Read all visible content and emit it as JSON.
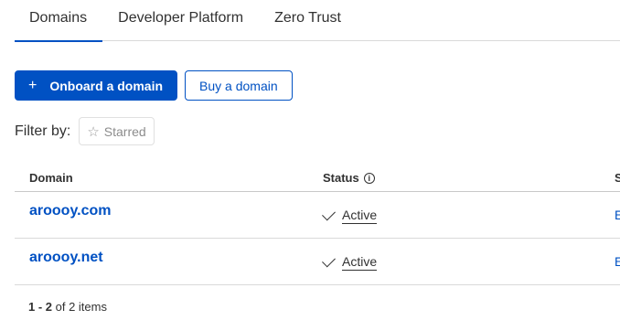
{
  "tabs": [
    {
      "label": "Domains",
      "active": true
    },
    {
      "label": "Developer Platform",
      "active": false
    },
    {
      "label": "Zero Trust",
      "active": false
    }
  ],
  "actions": {
    "onboard_icon": "plus-icon",
    "onboard_label": "Onboard a domain",
    "buy_label": "Buy a domain"
  },
  "filter": {
    "label": "Filter by:",
    "starred_icon": "star-icon",
    "starred_label": "Starred"
  },
  "table": {
    "columns": [
      "Domain",
      "Status",
      "S"
    ],
    "rows": [
      {
        "domain": "aroooy.com",
        "status": "Active",
        "third": "E"
      },
      {
        "domain": "aroooy.net",
        "status": "Active",
        "third": "E"
      }
    ]
  },
  "pagination": {
    "range": "1 - 2",
    "suffix": " of 2 items"
  },
  "colors": {
    "accent": "#0051c3",
    "text": "#313131",
    "border": "#d9d9d9"
  }
}
